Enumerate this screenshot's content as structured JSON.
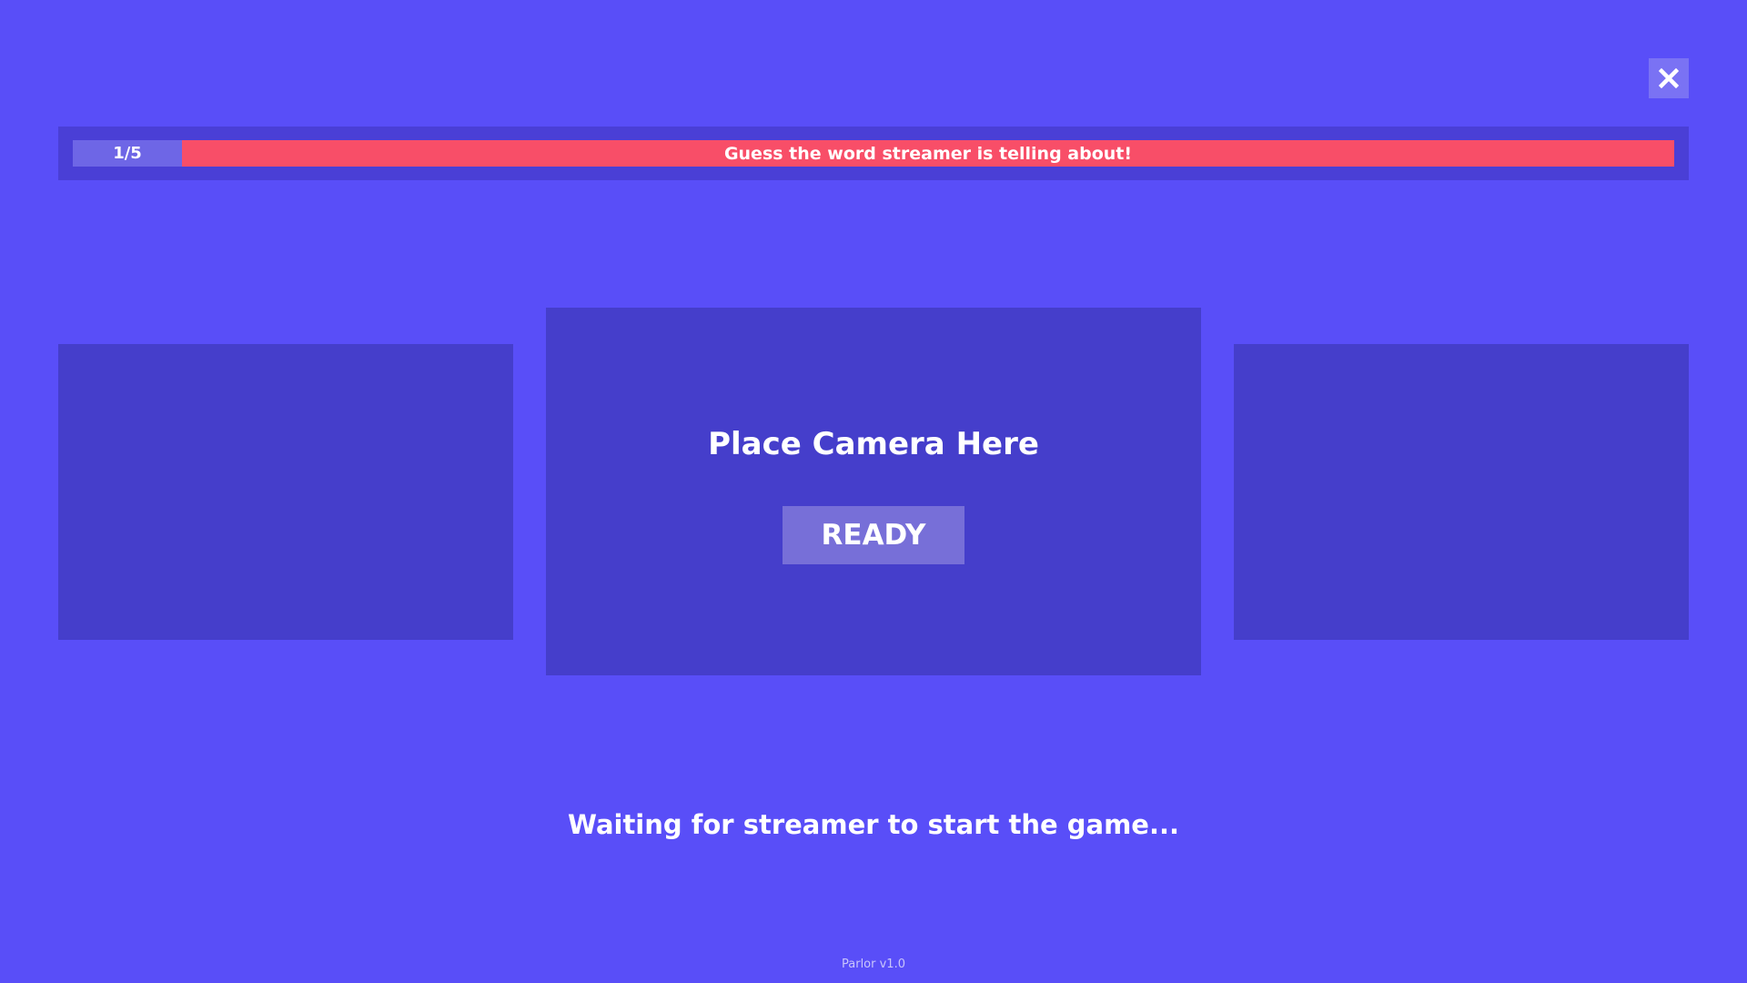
{
  "colors": {
    "background": "#594ef8",
    "header_bar": "#4a3fd6",
    "round_indicator": "#6e66e6",
    "prompt_banner": "#f84e68",
    "panel": "#453ecb",
    "ready_button": "#776fd8",
    "close_button": "#7a72f4"
  },
  "close_button": {
    "icon": "close-icon"
  },
  "header": {
    "round": "1/5",
    "prompt": "Guess the word streamer is telling about!"
  },
  "camera_panel": {
    "title": "Place Camera Here",
    "ready_label": "READY"
  },
  "status": {
    "message": "Waiting for streamer to start the game..."
  },
  "footer": {
    "version": "Parlor v1.0"
  }
}
